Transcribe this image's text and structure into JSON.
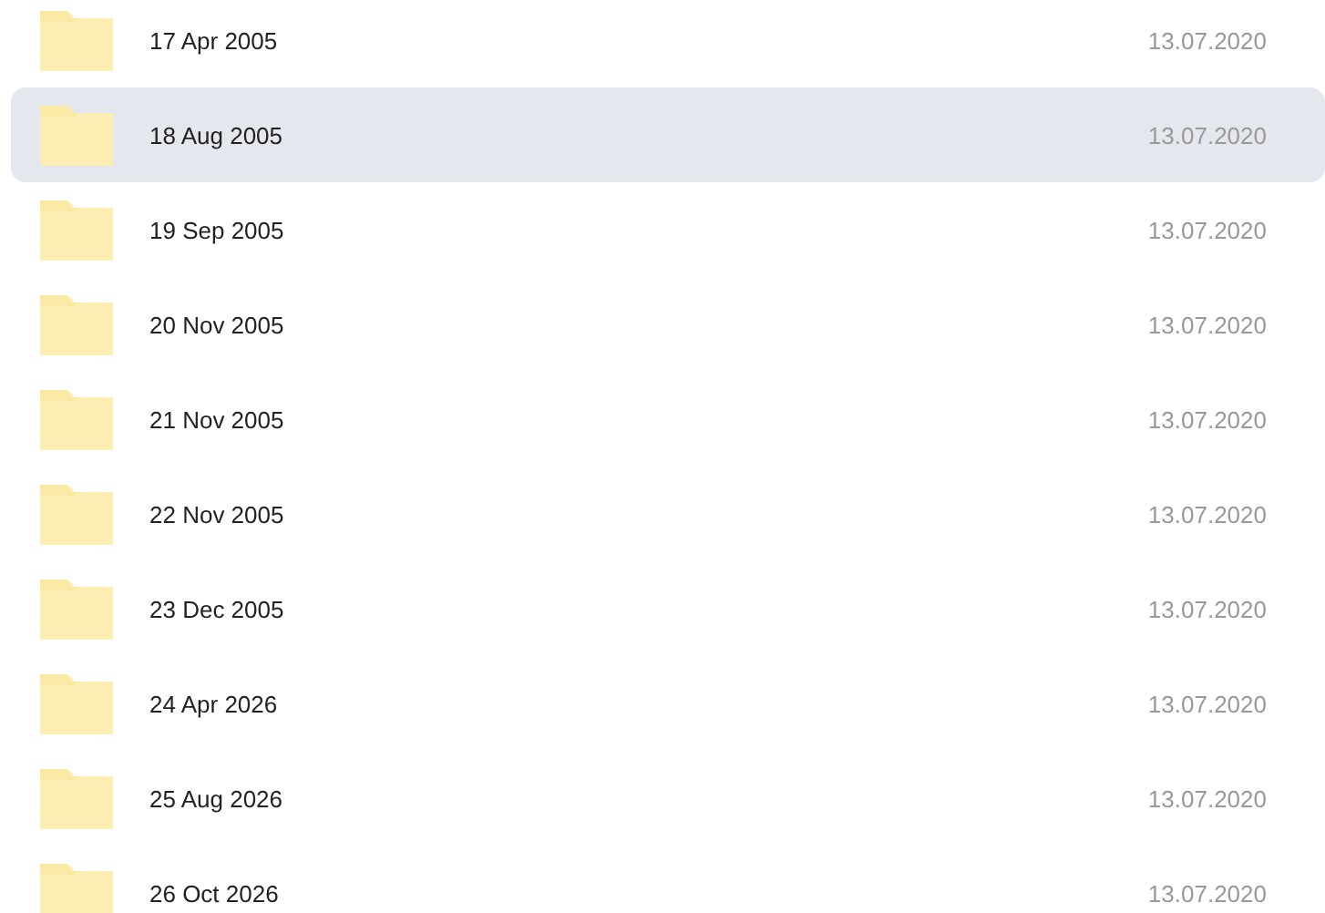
{
  "folders": [
    {
      "name": "17 Apr 2005",
      "modified": "13.07.2020",
      "selected": false
    },
    {
      "name": "18 Aug 2005",
      "modified": "13.07.2020",
      "selected": true
    },
    {
      "name": "19 Sep 2005",
      "modified": "13.07.2020",
      "selected": false
    },
    {
      "name": "20 Nov 2005",
      "modified": "13.07.2020",
      "selected": false
    },
    {
      "name": "21 Nov 2005",
      "modified": "13.07.2020",
      "selected": false
    },
    {
      "name": "22 Nov 2005",
      "modified": "13.07.2020",
      "selected": false
    },
    {
      "name": "23 Dec 2005",
      "modified": "13.07.2020",
      "selected": false
    },
    {
      "name": "24 Apr 2026",
      "modified": "13.07.2020",
      "selected": false
    },
    {
      "name": "25 Aug 2026",
      "modified": "13.07.2020",
      "selected": false
    },
    {
      "name": "26 Oct 2026",
      "modified": "13.07.2020",
      "selected": false
    }
  ]
}
